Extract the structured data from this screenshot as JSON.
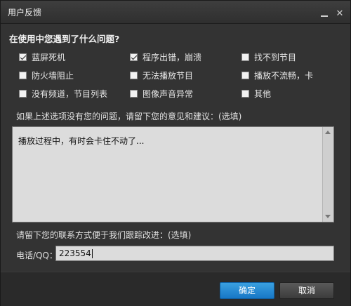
{
  "window": {
    "title": "用户反馈"
  },
  "question": "在使用中您遇到了什么问题?",
  "options": [
    {
      "label": "蓝屏死机",
      "checked": true
    },
    {
      "label": "程序出错，崩溃",
      "checked": true
    },
    {
      "label": "找不到节目",
      "checked": false
    },
    {
      "label": "防火墙阻止",
      "checked": false
    },
    {
      "label": "无法播放节目",
      "checked": false
    },
    {
      "label": "播放不流畅，卡",
      "checked": false
    },
    {
      "label": "没有频道，节目列表",
      "checked": false
    },
    {
      "label": "图像声音异常",
      "checked": false
    },
    {
      "label": "其他",
      "checked": false
    }
  ],
  "suggestion": {
    "hint": "如果上述选项没有您的问题，请留下您的意见和建议：(选填)",
    "value": "播放过程中，有时会卡住不动了..."
  },
  "contact": {
    "hint": "请留下您的联系方式便于我们跟踪改进：(选填)",
    "label": "电话/QQ：",
    "value": "223554"
  },
  "buttons": {
    "ok": "确定",
    "cancel": "取消"
  },
  "colors": {
    "accent": "#1e88d4",
    "background": "#333333"
  }
}
